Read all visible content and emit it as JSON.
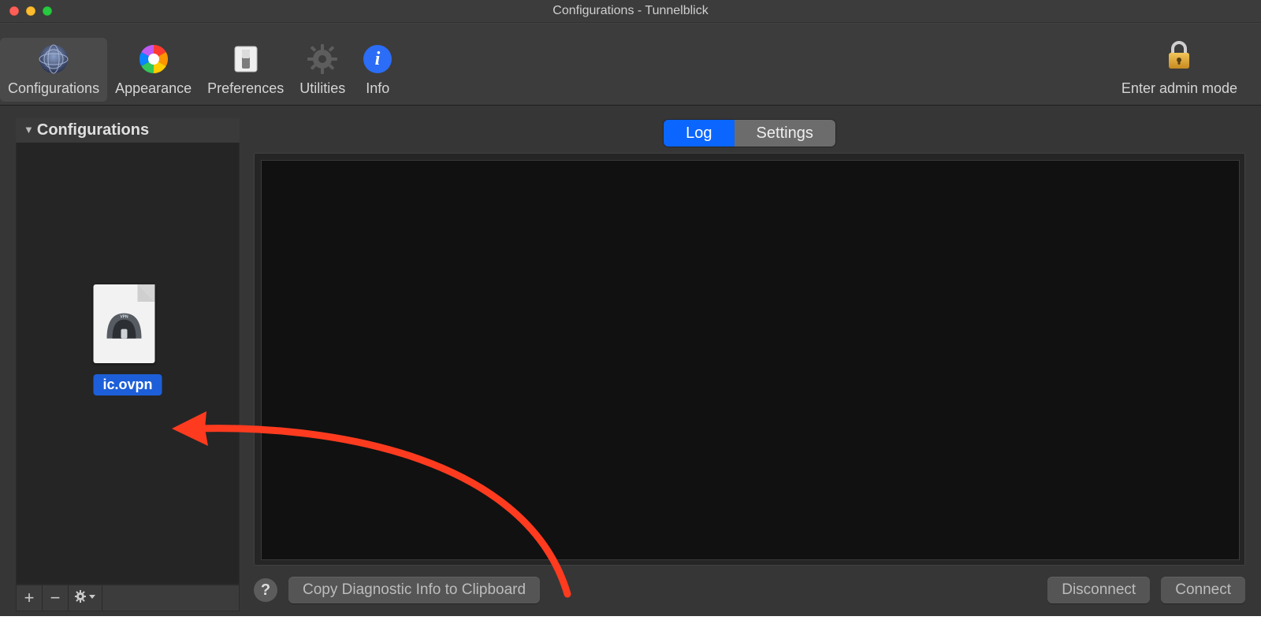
{
  "window": {
    "title": "Configurations - Tunnelblick"
  },
  "toolbar": {
    "items": [
      {
        "label": "Configurations",
        "icon": "globe-icon",
        "selected": true
      },
      {
        "label": "Appearance",
        "icon": "color-wheel-icon",
        "selected": false
      },
      {
        "label": "Preferences",
        "icon": "switch-icon",
        "selected": false
      },
      {
        "label": "Utilities",
        "icon": "gear-icon",
        "selected": false
      },
      {
        "label": "Info",
        "icon": "info-icon",
        "selected": false
      }
    ],
    "admin_label": "Enter admin mode"
  },
  "sidebar": {
    "header": "Configurations",
    "file_label": "ic.ovpn",
    "footer": {
      "add_label": "+",
      "remove_label": "−",
      "gear_label": "⚙▾"
    }
  },
  "main": {
    "tabs": [
      {
        "label": "Log",
        "active": true
      },
      {
        "label": "Settings",
        "active": false
      }
    ],
    "buttons": {
      "help": "?",
      "copy_diag": "Copy Diagnostic Info to Clipboard",
      "disconnect": "Disconnect",
      "connect": "Connect"
    }
  }
}
